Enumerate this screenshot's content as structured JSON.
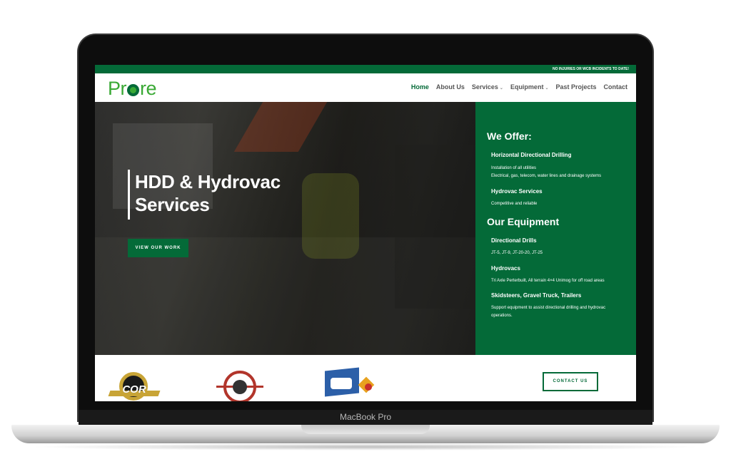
{
  "device": {
    "label": "MacBook Pro"
  },
  "site": {
    "topbar_text": "NO INJURIES OR WCB INCIDENTS TO DATE!",
    "logo": {
      "part1": "Pr",
      "part2": "C",
      "part3": "re"
    },
    "nav": [
      {
        "label": "Home",
        "active": true
      },
      {
        "label": "About Us"
      },
      {
        "label": "Services",
        "dropdown": true
      },
      {
        "label": "Equipment",
        "dropdown": true
      },
      {
        "label": "Past Projects"
      },
      {
        "label": "Contact"
      }
    ],
    "hero": {
      "title_line1": "HDD & Hydrovac",
      "title_line2": "Services",
      "button": "VIEW OUR WORK"
    },
    "panel": {
      "offer_heading": "We Offer:",
      "hdd_title": "Horizontal Directional Drilling",
      "hdd_line1": "Installation of all utilities",
      "hdd_line2": "Electrical, gas, telecom, water lines and drainage systems",
      "hydrovac_title": "Hydrovac Services",
      "hydrovac_line1": "Competitive and reliable",
      "equipment_heading": "Our Equipment",
      "drills_title": "Directional Drills",
      "drills_line1": "JT-5, JT-9, JT-20-20, JT-25",
      "vacs_title": "Hydrovacs",
      "vacs_line1": "Tri Axle Perterbuilt, All terrain 4×4 Unimog for off road areas",
      "skid_title": "Skidsteers, Gravel Truck, Trailers",
      "skid_line1": "Support equipment to assist directional drilling and hydrovac",
      "skid_line2": "operations."
    },
    "strip": {
      "cor_text": "COR",
      "contact_button": "CONTACT US"
    }
  },
  "colors": {
    "brand_green": "#046a38",
    "logo_green": "#3aa935"
  }
}
